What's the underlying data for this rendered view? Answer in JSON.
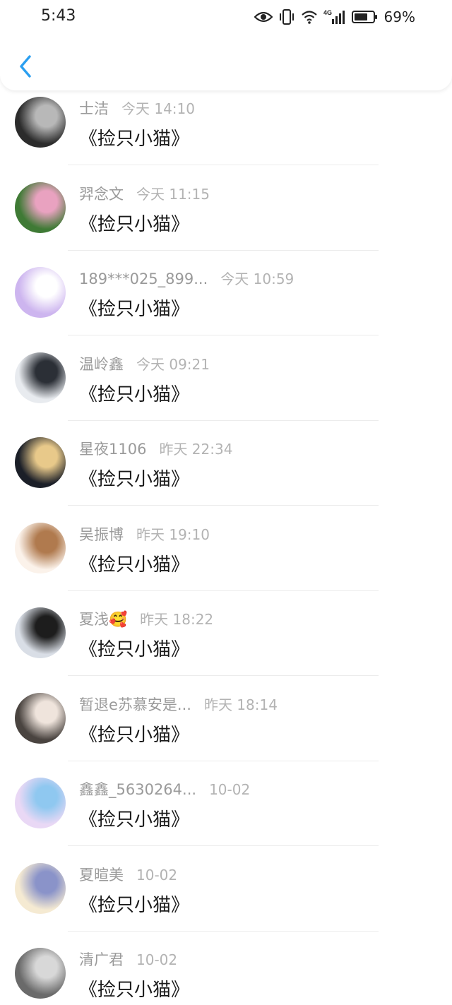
{
  "status_bar": {
    "time": "5:43",
    "battery_percent": "69%",
    "network_type": "4G",
    "icons": [
      "eye-icon",
      "vibrate-icon",
      "wifi-icon",
      "signal-icon",
      "battery-icon"
    ]
  },
  "header": {
    "back_icon": "chevron-left-icon",
    "accent_color": "#2b9ff0"
  },
  "items": [
    {
      "name": "士洁",
      "time": "今天 14:10",
      "title": "《捡只小猫》",
      "avatar_colors": [
        "#2c2c2c",
        "#b8b8b8"
      ]
    },
    {
      "name": "羿念文",
      "time": "今天 11:15",
      "title": "《捡只小猫》",
      "avatar_colors": [
        "#3f7a35",
        "#e9a2c0"
      ]
    },
    {
      "name": "189***025_899...",
      "time": "今天 10:59",
      "title": "《捡只小猫》",
      "avatar_colors": [
        "#cdb5ef",
        "#ffffff"
      ]
    },
    {
      "name": "温岭鑫",
      "time": "今天 09:21",
      "title": "《捡只小猫》",
      "avatar_colors": [
        "#e8ebef",
        "#2b2f36"
      ]
    },
    {
      "name": "星夜1106",
      "time": "昨天 22:34",
      "title": "《捡只小猫》",
      "avatar_colors": [
        "#1b1f28",
        "#e8c98a"
      ]
    },
    {
      "name": "吴振博",
      "time": "昨天 19:10",
      "title": "《捡只小猫》",
      "avatar_colors": [
        "#fbf2ea",
        "#b07a4e"
      ]
    },
    {
      "name": "夏浅🥰",
      "time": "昨天 18:22",
      "title": "《捡只小猫》",
      "avatar_colors": [
        "#d9dee6",
        "#1d1d1d"
      ]
    },
    {
      "name": "暂退e苏慕安是...",
      "time": "昨天 18:14",
      "title": "《捡只小猫》",
      "avatar_colors": [
        "#4a4440",
        "#efe4dc"
      ]
    },
    {
      "name": "鑫鑫_5630264...",
      "time": "10-02",
      "title": "《捡只小猫》",
      "avatar_colors": [
        "#e9d8f5",
        "#8fc8f0"
      ]
    },
    {
      "name": "夏暄美",
      "time": "10-02",
      "title": "《捡只小猫》",
      "avatar_colors": [
        "#f5ead2",
        "#8a93c9"
      ]
    },
    {
      "name": "清广君",
      "time": "10-02",
      "title": "《捡只小猫》",
      "avatar_colors": [
        "#6a6a6a",
        "#d8d8d8"
      ]
    }
  ]
}
